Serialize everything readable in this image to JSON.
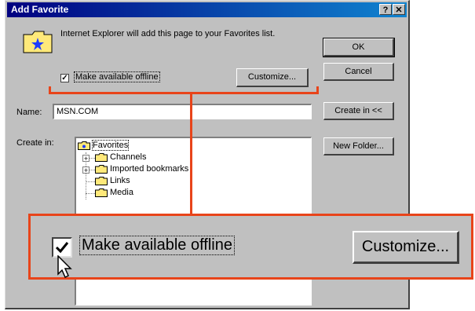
{
  "dialog": {
    "title": "Add Favorite",
    "help_glyph": "?",
    "close_glyph": "✕",
    "message": "Internet Explorer will add this page to your Favorites list.",
    "offline_label": "Make available offline",
    "offline_checked": true,
    "check_glyph": "✓",
    "customize_label": "Customize...",
    "ok_label": "OK",
    "cancel_label": "Cancel",
    "name_label": "Name:",
    "name_value": "MSN.COM",
    "create_in_label": "Create in:",
    "create_in_button_label": "Create in <<",
    "new_folder_label": "New Folder...",
    "tree": {
      "items": [
        {
          "label": "Favorites",
          "expander": "",
          "selected": true
        },
        {
          "label": "Channels",
          "expander": "+"
        },
        {
          "label": "Imported bookmarks",
          "expander": "+"
        },
        {
          "label": "Links",
          "expander": ""
        },
        {
          "label": "Media",
          "expander": ""
        }
      ]
    }
  },
  "zoom": {
    "offline_label": "Make available offline",
    "customize_label": "Customize...",
    "check_glyph": "✓"
  },
  "colors": {
    "title_bar_start": "#000080",
    "title_bar_end": "#1084d0",
    "dialog_face": "#c0c0c0",
    "callout_red": "#e8441a",
    "folder_yellow": "#ffe97a"
  },
  "icons": [
    "favorites-folder-icon",
    "folder-icon",
    "checkbox-check-icon",
    "mouse-pointer-icon"
  ]
}
